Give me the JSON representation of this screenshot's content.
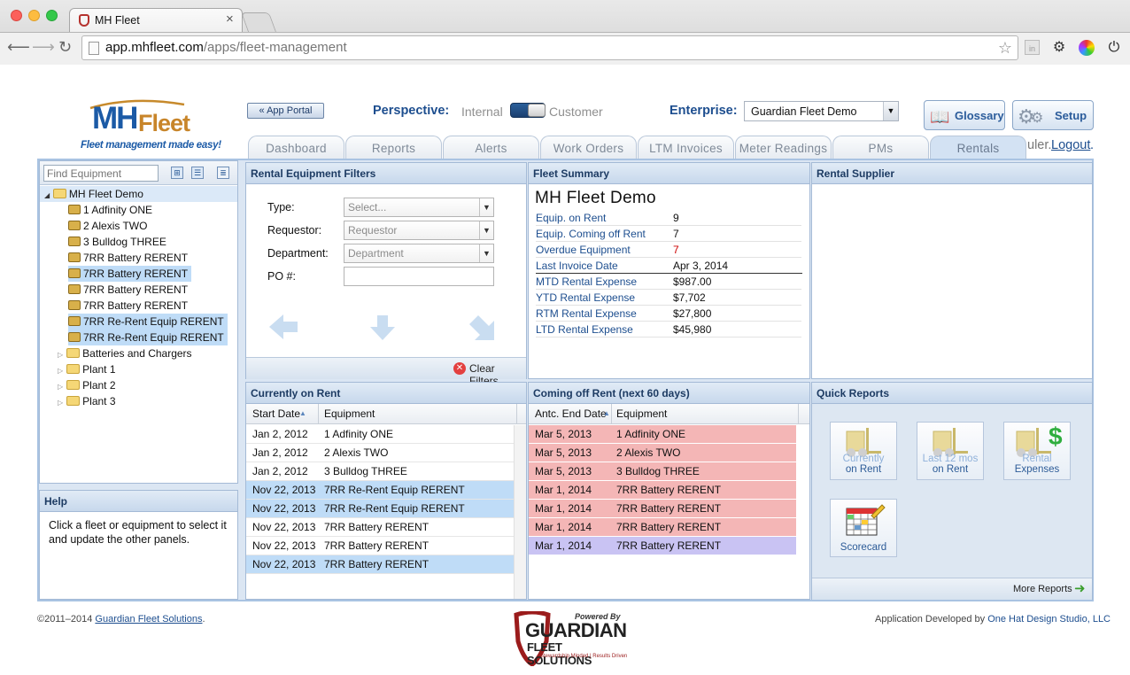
{
  "browser": {
    "tab_title": "MH Fleet",
    "url_domain": "app.mhfleet.com",
    "url_path": "/apps/fleet-management"
  },
  "header": {
    "logo_mh": "MH",
    "logo_fleet": "Fleet",
    "tagline": "Fleet management made easy!",
    "app_portal_label": "« App Portal",
    "perspective_label": "Perspective:",
    "perspective_internal": "Internal",
    "perspective_customer": "Customer",
    "enterprise_label": "Enterprise:",
    "enterprise_value": "Guardian Fleet Demo",
    "glossary_label": "Glossary",
    "setup_label": "Setup",
    "user_fragment": "uler.",
    "logout_label": "Logout",
    "logout_trail": "."
  },
  "tabs": [
    {
      "label": "Dashboard"
    },
    {
      "label": "Reports"
    },
    {
      "label": "Alerts"
    },
    {
      "label": "Work Orders"
    },
    {
      "label": "LTM Invoices"
    },
    {
      "label": "Meter Readings"
    },
    {
      "label": "PMs"
    },
    {
      "label": "Rentals"
    }
  ],
  "sidebar": {
    "search_placeholder": "Find Equipment",
    "root": "MH Fleet Demo",
    "equipment": [
      {
        "label": "1 Adfinity ONE",
        "selected": false
      },
      {
        "label": "2 Alexis TWO",
        "selected": false
      },
      {
        "label": "3 Bulldog THREE",
        "selected": false
      },
      {
        "label": "7RR Battery RERENT",
        "selected": false
      },
      {
        "label": "7RR Battery RERENT",
        "selected": true
      },
      {
        "label": "7RR Battery RERENT",
        "selected": false
      },
      {
        "label": "7RR Battery RERENT",
        "selected": false
      },
      {
        "label": "7RR Re-Rent Equip RERENT",
        "selected": true
      },
      {
        "label": "7RR Re-Rent Equip RERENT",
        "selected": true
      }
    ],
    "folders": [
      {
        "label": "Batteries and Chargers"
      },
      {
        "label": "Plant 1"
      },
      {
        "label": "Plant 2"
      },
      {
        "label": "Plant 3"
      }
    ]
  },
  "help": {
    "title": "Help",
    "text": "Click a fleet or equipment to select it and update the other panels."
  },
  "filters": {
    "title": "Rental Equipment Filters",
    "type_label": "Type:",
    "type_value": "Select...",
    "requestor_label": "Requestor:",
    "requestor_value": "Requestor",
    "department_label": "Department:",
    "department_value": "Department",
    "po_label": "PO #:",
    "po_value": "",
    "clear_label": "Clear Filters"
  },
  "summary": {
    "title": "Fleet Summary",
    "fleet_name": "MH Fleet Demo",
    "rows": [
      {
        "label": "Equip. on Rent",
        "value": "9"
      },
      {
        "label": "Equip. Coming off Rent",
        "value": "7"
      },
      {
        "label": "Overdue Equipment",
        "value": "7"
      },
      {
        "label": "Last Invoice Date",
        "value": "Apr 3, 2014"
      },
      {
        "label": "MTD Rental Expense",
        "value": "$987.00"
      },
      {
        "label": "YTD Rental Expense",
        "value": "$7,702"
      },
      {
        "label": "RTM Rental Expense",
        "value": "$27,800"
      },
      {
        "label": "LTD Rental Expense",
        "value": "$45,980"
      }
    ],
    "overdue_color": "#cc0000"
  },
  "supplier": {
    "title": "Rental Supplier"
  },
  "on_rent": {
    "title": "Currently on Rent",
    "col_date": "Start Date",
    "col_equipment": "Equipment",
    "rows": [
      {
        "date": "Jan 2, 2012",
        "equipment": "1 Adfinity ONE",
        "selected": false
      },
      {
        "date": "Jan 2, 2012",
        "equipment": "2 Alexis TWO",
        "selected": false
      },
      {
        "date": "Jan 2, 2012",
        "equipment": "3 Bulldog THREE",
        "selected": false
      },
      {
        "date": "Nov 22, 2013",
        "equipment": "7RR Re-Rent Equip RERENT",
        "selected": true
      },
      {
        "date": "Nov 22, 2013",
        "equipment": "7RR Re-Rent Equip RERENT",
        "selected": true
      },
      {
        "date": "Nov 22, 2013",
        "equipment": "7RR Battery RERENT",
        "selected": false
      },
      {
        "date": "Nov 22, 2013",
        "equipment": "7RR Battery RERENT",
        "selected": false
      },
      {
        "date": "Nov 22, 2013",
        "equipment": "7RR Battery RERENT",
        "selected": true
      }
    ]
  },
  "coming_off": {
    "title": "Coming off Rent (next 60 days)",
    "col_date": "Antc. End Date",
    "col_equipment": "Equipment",
    "rows": [
      {
        "date": "Mar 5, 2013",
        "equipment": "1 Adfinity ONE",
        "status": "overdue"
      },
      {
        "date": "Mar 5, 2013",
        "equipment": "2 Alexis TWO",
        "status": "overdue"
      },
      {
        "date": "Mar 5, 2013",
        "equipment": "3 Bulldog THREE",
        "status": "overdue"
      },
      {
        "date": "Mar 1, 2014",
        "equipment": "7RR Battery RERENT",
        "status": "overdue"
      },
      {
        "date": "Mar 1, 2014",
        "equipment": "7RR Battery RERENT",
        "status": "overdue"
      },
      {
        "date": "Mar 1, 2014",
        "equipment": "7RR Battery RERENT",
        "status": "overdue"
      },
      {
        "date": "Mar 1, 2014",
        "equipment": "7RR Battery RERENT",
        "status": "selected"
      }
    ],
    "overdue_color": "#f4b6b6",
    "selected_color": "#c9c3f3"
  },
  "quick_reports": {
    "title": "Quick Reports",
    "items": [
      {
        "line1": "Currently",
        "line2": "on Rent"
      },
      {
        "line1": "Last 12 mos",
        "line2": "on Rent"
      },
      {
        "line1": "Rental",
        "line2": "Expenses"
      },
      {
        "line1": "Scorecard",
        "line2": ""
      }
    ],
    "more_label": "More Reports"
  },
  "footer": {
    "copyright": "©2011–2014 ",
    "company_link": "Guardian Fleet Solutions",
    "copyright_end": ".",
    "powered_by": "Powered By",
    "brand_big": "GUARDIAN",
    "brand_small": "FLEET SOLUTIONS",
    "brand_tag": "Stewardship Minded | Results Driven",
    "developer_prefix": "Application Developed by ",
    "developer_link": "One Hat Design Studio, LLC"
  },
  "colors": {
    "accent": "#1d4e8f",
    "panel_border": "#a4bad6",
    "selection": "#bfdcf7"
  }
}
